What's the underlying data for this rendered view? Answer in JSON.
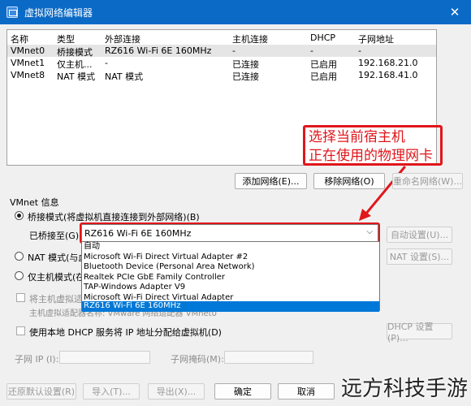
{
  "window": {
    "title": "虚拟网络编辑器"
  },
  "table": {
    "headers": [
      "名称",
      "类型",
      "外部连接",
      "主机连接",
      "DHCP",
      "子网地址"
    ],
    "rows": [
      [
        "VMnet0",
        "桥接模式",
        "RZ616 Wi-Fi 6E 160MHz",
        "-",
        "-",
        "-"
      ],
      [
        "VMnet1",
        "仅主机...",
        "-",
        "已连接",
        "已启用",
        "192.168.21.0"
      ],
      [
        "VMnet8",
        "NAT 模式",
        "NAT 模式",
        "已连接",
        "已启用",
        "192.168.41.0"
      ]
    ]
  },
  "annotation": {
    "line1": "选择当前宿主机",
    "line2": "正在使用的物理网卡"
  },
  "buttons": {
    "add_network": "添加网络(E)...",
    "remove_network": "移除网络(O)",
    "rename_network": "重命名网络(W)...",
    "auto_settings": "自动设置(U)...",
    "nat_settings": "NAT 设置(S)...",
    "dhcp_settings": "DHCP 设置(P)...",
    "restore_defaults": "还原默认设置(R)",
    "import": "导入(T)...",
    "export": "导出(X)...",
    "ok": "确定",
    "cancel": "取消"
  },
  "vmnet_info": {
    "section_label": "VMnet 信息",
    "bridged_label": "桥接模式(将虚拟机直接连接到外部网络)(B)",
    "bridged_to_label": "已桥接至(G):",
    "bridged_to_value": "RZ616 Wi-Fi 6E 160MHz",
    "nat_label": "NAT 模式(与虚",
    "hostonly_label": "仅主机模式(在",
    "connect_host_adapter": "将主机虚拟适",
    "host_adapter_name": "主机虚拟适配器名称: VMware 网络适配器 VMnet0",
    "use_dhcp": "使用本地 DHCP 服务将 IP 地址分配给虚拟机(D)",
    "subnet_ip_label": "子网 IP (I):",
    "subnet_mask_label": "子网掩码(M):"
  },
  "dropdown_options": [
    "自动",
    "Microsoft Wi-Fi Direct Virtual Adapter #2",
    "Bluetooth Device (Personal Area Network)",
    "Realtek PCIe GbE Family Controller",
    "TAP-Windows Adapter V9",
    "Microsoft Wi-Fi Direct Virtual Adapter",
    "RZ616 Wi-Fi 6E 160MHz"
  ],
  "dropdown_selected_index": 6,
  "watermark": "远方科技手游",
  "colors": {
    "titlebar": "#0a6ac6",
    "annotation": "#e0161b",
    "highlight": "#0078d7"
  }
}
